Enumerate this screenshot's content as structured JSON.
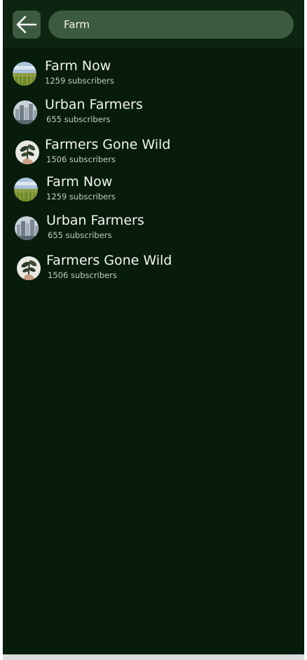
{
  "search": {
    "value": "Farm"
  },
  "results": [
    {
      "name": "Farm Now",
      "subscribers": "1259 subscribers",
      "avatar": "wheat-field-image"
    },
    {
      "name": "Urban Farmers",
      "subscribers": "655 subscribers",
      "avatar": "city-skyline-image"
    },
    {
      "name": "Farmers Gone Wild",
      "subscribers": "1506 subscribers",
      "avatar": "plant-in-hand-image"
    },
    {
      "name": "Farm Now",
      "subscribers": "1259 subscribers",
      "avatar": "wheat-field-image"
    },
    {
      "name": "Urban Farmers",
      "subscribers": "655 subscribers",
      "avatar": "city-skyline-image"
    },
    {
      "name": "Farmers Gone Wild",
      "subscribers": "1506 subscribers",
      "avatar": "plant-in-hand-image"
    }
  ],
  "colors": {
    "background": "#071c0b",
    "header": "#0c2410",
    "control": "#3c5a40",
    "text": "#f2f5f0"
  }
}
